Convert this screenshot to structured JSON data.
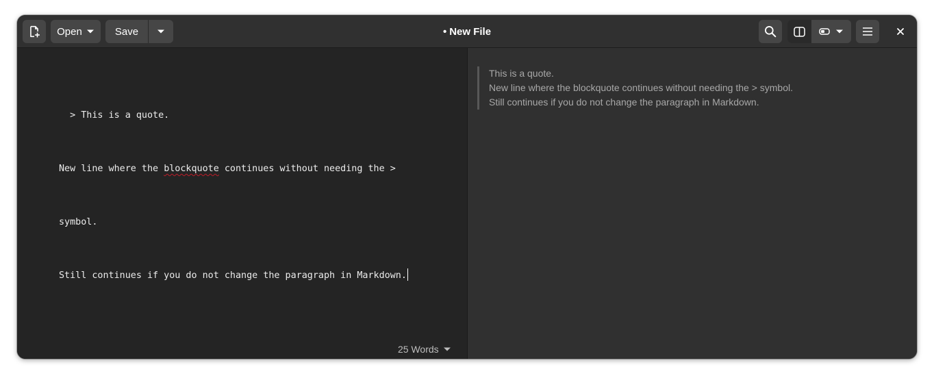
{
  "window": {
    "title": "New File",
    "modified_marker": "•"
  },
  "toolbar": {
    "new_file_icon": "document-new-icon",
    "open_label": "Open",
    "save_label": "Save",
    "search_icon": "search-icon",
    "split_view_icon": "split-view-icon",
    "view_mode_icon": "view-mode-icon",
    "menu_icon": "hamburger-menu-icon",
    "close_icon": "close-icon"
  },
  "editor": {
    "line_1_prefix": "  > This is a quote.",
    "line_2_before": "New line where the ",
    "line_2_misspelled": "blockquote",
    "line_2_after": " continues without needing the >",
    "line_3": "symbol.",
    "line_4": "Still continues if you do not change the paragraph in Markdown."
  },
  "status": {
    "word_count": "25 Words"
  },
  "preview": {
    "quote_lines": [
      "This is a quote.",
      "New line where the blockquote continues without needing the > symbol.",
      "Still continues if you do not change the paragraph in Markdown."
    ]
  },
  "colors": {
    "window_bg": "#242424",
    "headerbar_bg": "#303030",
    "button_bg": "#464646",
    "preview_bg": "#303030",
    "spell_error": "#c01c28"
  }
}
